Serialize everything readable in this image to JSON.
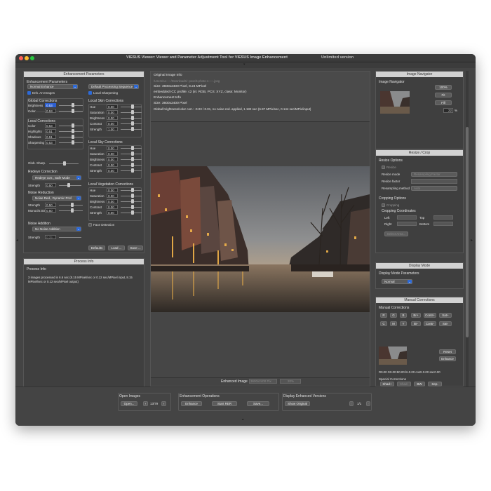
{
  "window": {
    "title": "VIESUS Viewer: Viewer and Parameter Adjustment Tool for VIESUS Image Enhancement",
    "version": "Unlimited version"
  },
  "left": {
    "enh_header": "Enhancement Parameters",
    "enh_params_label": "Enhancement Parameters",
    "mode_select": "Normal Enhance",
    "processing_select": "Default Processing Sequence",
    "enh_art_label": "Enh. Art.Images",
    "local_sharp_label": "Local Sharpening",
    "global_corr": {
      "title": "Global Corrections",
      "rows": [
        {
          "label": "Brightness",
          "value": "0.53"
        },
        {
          "label": "Color",
          "value": "0.53"
        }
      ]
    },
    "local_corr": {
      "title": "Local Corrections",
      "rows": [
        {
          "label": "Color",
          "value": "0.53"
        },
        {
          "label": "Highlights",
          "value": "0.51"
        },
        {
          "label": "Shadows",
          "value": "0.51"
        },
        {
          "label": "Sharpening",
          "value": "0.53"
        }
      ]
    },
    "glob_sharp": "Glob. Sharp.",
    "redeye": {
      "title": "Redeye Correction",
      "select": "Redeye corr., Safe Mode",
      "strength_label": "Strength",
      "strength": "0.50"
    },
    "noise": {
      "title": "Noise Reduction",
      "select": "Noise Red., Dynamic Prof.",
      "rows": [
        {
          "label": "Strength",
          "value": "0.50"
        },
        {
          "label": "Monochr.Str.",
          "value": "0.50"
        }
      ]
    },
    "noise_add": {
      "title": "Noise Addition",
      "select": "No Noise Addition",
      "strength_label": "Strength",
      "strength": "0.25"
    },
    "face_detection": "Face Detection",
    "skin": {
      "title": "Local Skin Corrections",
      "rows": [
        {
          "label": "Hue",
          "value": "0.00"
        },
        {
          "label": "Saturation",
          "value": "0.00"
        },
        {
          "label": "Brightness",
          "value": "0.00"
        },
        {
          "label": "Contrast",
          "value": "0.00"
        },
        {
          "label": "Strength",
          "value": "1.00"
        }
      ]
    },
    "sky": {
      "title": "Local Sky Corrections",
      "rows": [
        {
          "label": "Hue",
          "value": "0.00"
        },
        {
          "label": "Saturation",
          "value": "0.00"
        },
        {
          "label": "Brightness",
          "value": "0.00"
        },
        {
          "label": "Contrast",
          "value": "0.00"
        },
        {
          "label": "Strength",
          "value": "0.00"
        }
      ]
    },
    "veg": {
      "title": "Local Vegetation Corrections",
      "rows": [
        {
          "label": "Hue",
          "value": "0.00"
        },
        {
          "label": "Saturation",
          "value": "0.00"
        },
        {
          "label": "Brightness",
          "value": "0.00"
        },
        {
          "label": "Contrast",
          "value": "0.00"
        },
        {
          "label": "Strength",
          "value": "0.00"
        }
      ]
    },
    "defaults_btn": "Defaults",
    "load_btn": "Load ...",
    "save_btn": "Save ...",
    "proc_header": "Process Info",
    "proc_title": "Process Info",
    "proc_line1": "3 images processed in 6.6 sec (8.15 MPixel/sec or 0.12 sec/MPixel input, 8.15",
    "proc_line2": "MPixel/sec or 0.12 sec/MPixel output)"
  },
  "center": {
    "orig_title": "Original Image Info",
    "orig_file": "/Users/ca-----/Downloads/--pexels-photo-1-----.jpeg",
    "orig_size": "Size: 3600x2400 Pixel, 8.24 MPixel",
    "orig_icc": "embedded ICC profile: c2 (in: RGB, PCS: XYZ, class: Monitor)",
    "enh_title": "Enhancement Info",
    "enh_size": "Size: 3600x2400 Pixel",
    "enh_global": "Global brightness/color corr.: -0.03 / 0.01, no noise red. applied, 1.182 sec (6.97 MPix/sec, 0.144 sec/MPix/input)",
    "enhanced_label": "Enhanced Image",
    "enhanced_size": "3600x2400 Pix",
    "enhanced_zoom": "20%"
  },
  "right": {
    "nav_header": "Image Navigator",
    "nav_title": "Image Navigator",
    "btn_100": "100%",
    "btn_fit": "Fit",
    "btn_fill": "Fill",
    "zoom_val": "22",
    "zoom_unit": "%",
    "resize_header": "Resize / Crop",
    "resize_opts": "Resize Options",
    "resize_cb": "Resize",
    "resize_mode_label": "Resize mode",
    "resize_mode": "Resampling Factor",
    "resize_factor_label": "Resize factor",
    "resamp_label": "Resampling method",
    "resamp_val": "Auto",
    "crop_opts": "Cropping Options",
    "cropping_cb": "Cropping",
    "crop_coords": "Cropping Coordinates",
    "left_lbl": "Left",
    "top_lbl": "Top",
    "right_lbl": "Right",
    "bottom_lbl": "Bottom",
    "select_area": "Select Area...",
    "display_header": "Display Mode",
    "display_params": "Display Mode Parameters",
    "display_val": "Normal",
    "manual_header": "Manual Corrections",
    "manual_title": "Manual Corrections",
    "row1": [
      "R",
      "G",
      "B",
      "Br+",
      "Contr+",
      "Sat+"
    ],
    "row2": [
      "C",
      "M",
      "Y",
      "Br-",
      "Contr-",
      "Sat-"
    ],
    "reset_btn": "Reset",
    "enhance_btn": "Enhance",
    "values_line": "R0.00 G0.00 B0.00 br.0.00 contr.0.00 sat.0.00",
    "special": "Special Corrections",
    "special_btns": [
      "Shad+",
      "Shad-",
      "BW",
      "Sep."
    ]
  },
  "bottom": {
    "open_title": "Open Images",
    "open_btn": "Open...",
    "counter": "13/79",
    "ops_title": "Enhancement Operations",
    "enhance_btn": "Enhance",
    "start_btn": "Start RER",
    "save_btn": "Save...",
    "disp_title": "Display Enhanced Versions",
    "show_orig": "Show Original",
    "ver_counter": "1/1"
  }
}
